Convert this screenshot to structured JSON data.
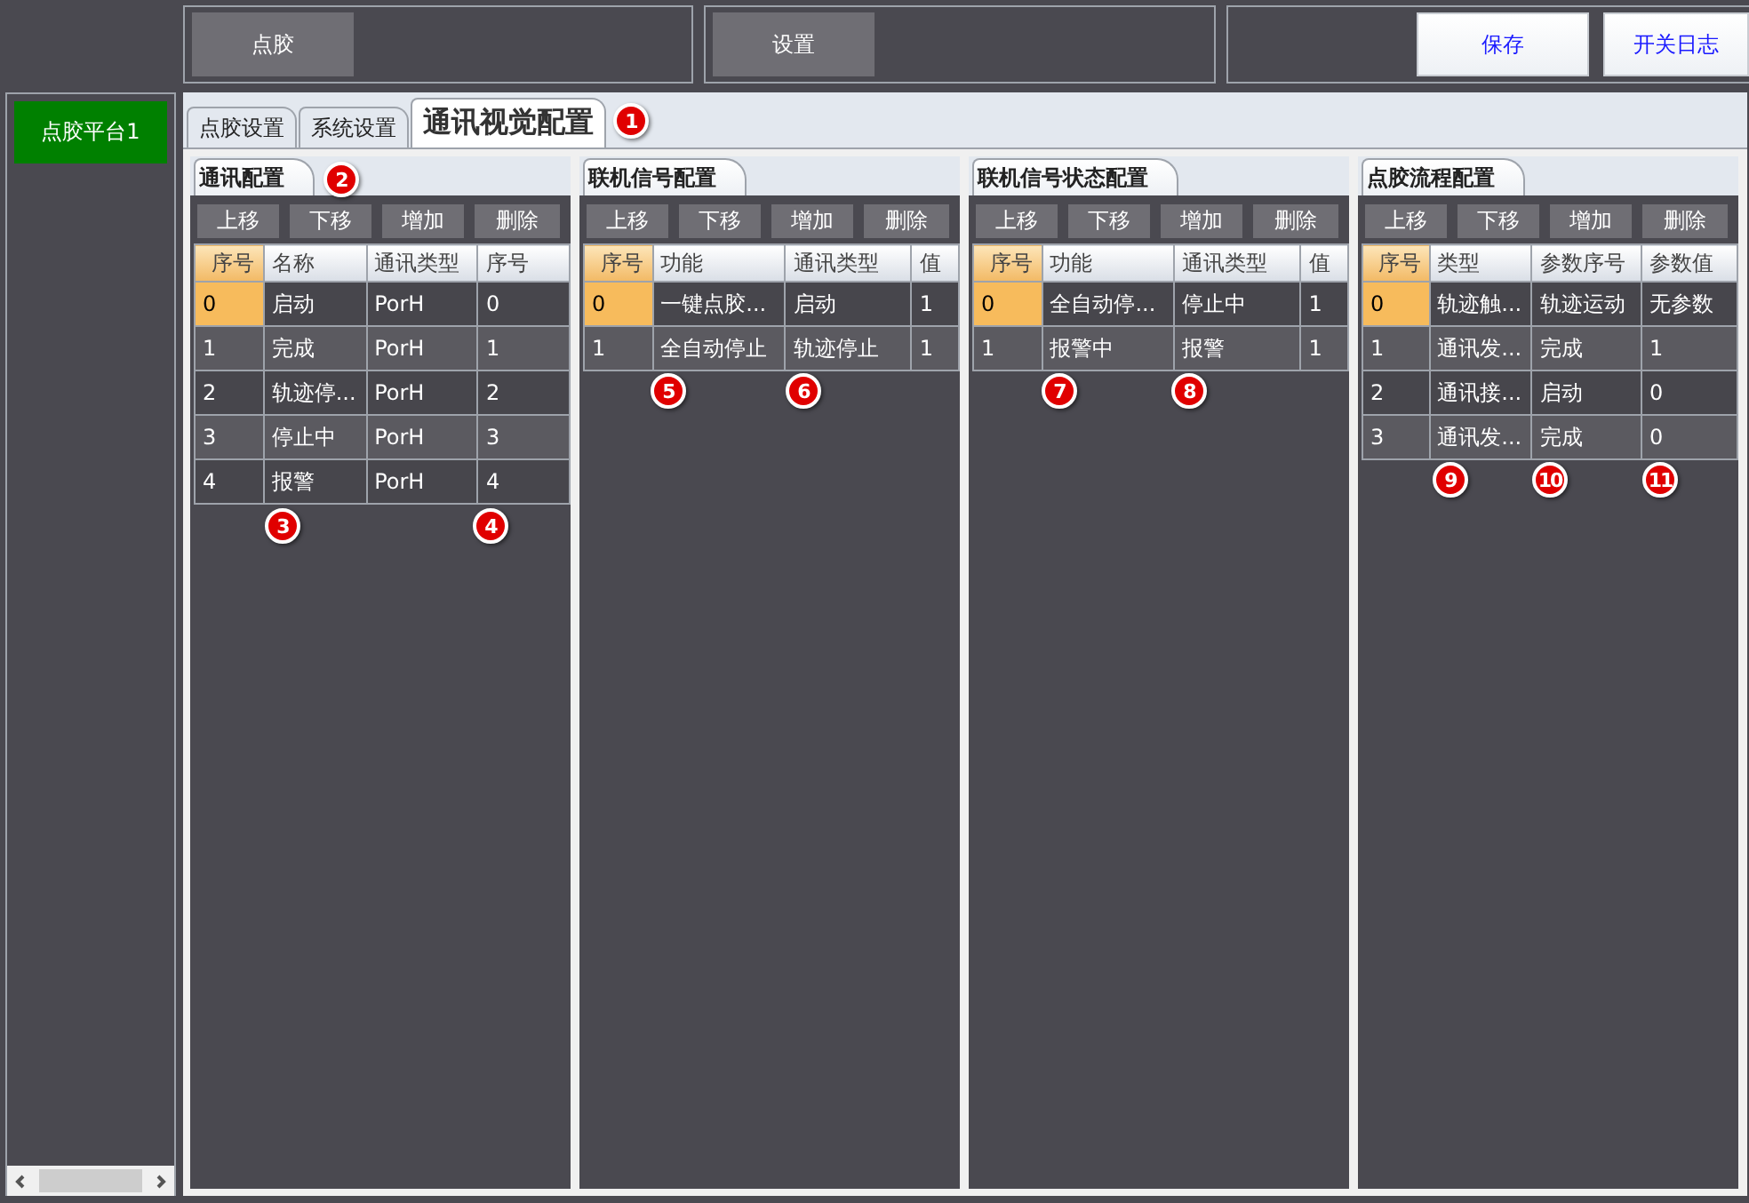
{
  "toolbar": {
    "groups": [
      {
        "buttons": [
          {
            "label": "点胶",
            "kind": "dark"
          }
        ]
      },
      {
        "buttons": [
          {
            "label": "设置",
            "kind": "dark"
          }
        ]
      },
      {
        "buttons": [
          {
            "label": "保存",
            "kind": "light"
          },
          {
            "label": "开关日志",
            "kind": "light"
          }
        ]
      }
    ]
  },
  "sidebar": {
    "items": [
      {
        "label": "点胶平台1",
        "selected": true
      }
    ]
  },
  "tabs": [
    {
      "label": "点胶设置",
      "selected": false
    },
    {
      "label": "系统设置",
      "selected": false
    },
    {
      "label": "通讯视觉配置",
      "selected": true
    }
  ],
  "panels": [
    {
      "title": "通讯配置",
      "buttons": [
        "上移",
        "下移",
        "增加",
        "删除"
      ],
      "columns": [
        "序号",
        "名称",
        "通讯类型",
        "序号"
      ],
      "rows": [
        {
          "cells": [
            "0",
            "启动",
            "PorH",
            "0"
          ],
          "selected": true
        },
        {
          "cells": [
            "1",
            "完成",
            "PorH",
            "1"
          ],
          "selected": false
        },
        {
          "cells": [
            "2",
            "轨迹停...",
            "PorH",
            "2"
          ],
          "selected": false
        },
        {
          "cells": [
            "3",
            "停止中",
            "PorH",
            "3"
          ],
          "selected": false
        },
        {
          "cells": [
            "4",
            "报警",
            "PorH",
            "4"
          ],
          "selected": false
        }
      ]
    },
    {
      "title": "联机信号配置",
      "buttons": [
        "上移",
        "下移",
        "增加",
        "删除"
      ],
      "columns": [
        "序号",
        "功能",
        "通讯类型",
        "值"
      ],
      "rows": [
        {
          "cells": [
            "0",
            "一键点胶...",
            "启动",
            "1"
          ],
          "selected": true
        },
        {
          "cells": [
            "1",
            "全自动停止",
            "轨迹停止",
            "1"
          ],
          "selected": false
        }
      ]
    },
    {
      "title": "联机信号状态配置",
      "buttons": [
        "上移",
        "下移",
        "增加",
        "删除"
      ],
      "columns": [
        "序号",
        "功能",
        "通讯类型",
        "值"
      ],
      "rows": [
        {
          "cells": [
            "0",
            "全自动停...",
            "停止中",
            "1"
          ],
          "selected": true
        },
        {
          "cells": [
            "1",
            "报警中",
            "报警",
            "1"
          ],
          "selected": false
        }
      ]
    },
    {
      "title": "点胶流程配置",
      "buttons": [
        "上移",
        "下移",
        "增加",
        "删除"
      ],
      "columns": [
        "序号",
        "类型",
        "参数序号",
        "参数值"
      ],
      "rows": [
        {
          "cells": [
            "0",
            "轨迹触...",
            "轨迹运动",
            "无参数"
          ],
          "selected": true
        },
        {
          "cells": [
            "1",
            "通讯发...",
            "完成",
            "1"
          ],
          "selected": false
        },
        {
          "cells": [
            "2",
            "通讯接...",
            "启动",
            "0"
          ],
          "selected": false
        },
        {
          "cells": [
            "3",
            "通讯发...",
            "完成",
            "0"
          ],
          "selected": false
        }
      ]
    }
  ],
  "markers": [
    "1",
    "2",
    "3",
    "4",
    "5",
    "6",
    "7",
    "8",
    "9",
    "10",
    "11"
  ]
}
